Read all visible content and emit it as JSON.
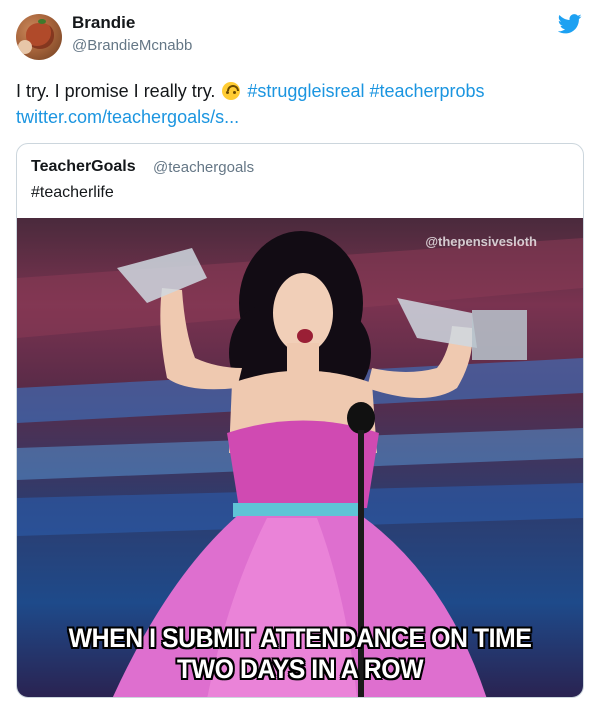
{
  "tweet": {
    "author_name": "Brandie",
    "author_handle": "@BrandieMcnabb",
    "text_before_emoji": "I try. I promise I really try.",
    "hashtag_1": "#struggleisreal",
    "hashtag_2": "#teacherprobs",
    "link": "twitter.com/teachergoals/s..."
  },
  "quoted_tweet": {
    "author_name": "TeacherGoals",
    "author_handle": "@teachergoals",
    "text": "#teacherlife",
    "media": {
      "watermark": "@thepensivesloth",
      "caption_line_1": "WHEN I SUBMIT ATTENDANCE ON TIME",
      "caption_line_2": "TWO DAYS IN A ROW"
    }
  },
  "icons": {
    "brand": "twitter-bird-icon",
    "emoji": "upside-down-face-emoji"
  },
  "colors": {
    "link": "#1b95e0",
    "text": "#14171a",
    "secondary": "#657786",
    "border": "#ccd6dd"
  }
}
